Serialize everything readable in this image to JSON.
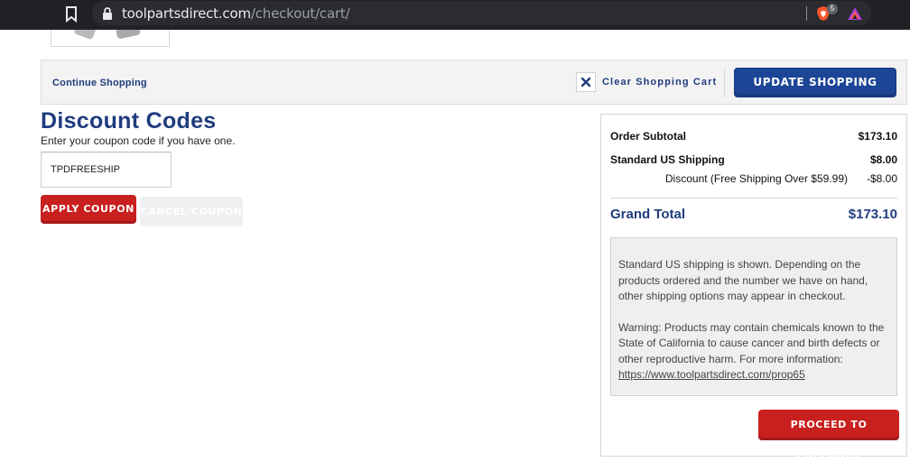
{
  "browser": {
    "url_host": "toolpartsdirect.com",
    "url_path": "/checkout/cart/",
    "brave_badge_count": "5",
    "icons": [
      "bookmark-icon",
      "lock-icon",
      "brave-shield-icon",
      "brave-rewards-icon"
    ]
  },
  "cart_actions": {
    "continue_label": "Continue Shopping",
    "clear_label": "Clear Shopping Cart",
    "update_label": "UPDATE SHOPPING CART"
  },
  "discount": {
    "title": "Discount Codes",
    "subtitle": "Enter your coupon code if you have one.",
    "coupon_value": "TPDFREESHIP",
    "apply_label": "APPLY COUPON",
    "cancel_label": "CANCEL COUPON"
  },
  "totals": {
    "subtotal_label": "Order Subtotal",
    "subtotal_value": "$173.10",
    "shipping_label": "Standard US Shipping",
    "shipping_value": "$8.00",
    "discount_label": "Discount (Free Shipping Over $59.99)",
    "discount_value": "-$8.00",
    "grand_label": "Grand Total",
    "grand_value": "$173.10",
    "info_shipping": "Standard US shipping is shown. Depending on the products ordered and the number we have on hand, other shipping options may appear in checkout.",
    "info_warning": "Warning: Products may contain chemicals known to the State of California to cause cancer and birth defects or other reproductive harm. For more information:",
    "info_link": "https://www.toolpartsdirect.com/prop65",
    "checkout_label": "PROCEED TO CHECKOUT"
  },
  "colors": {
    "brand_blue": "#1f3c7d",
    "button_blue": "#1c4596",
    "button_red": "#c8201f"
  }
}
